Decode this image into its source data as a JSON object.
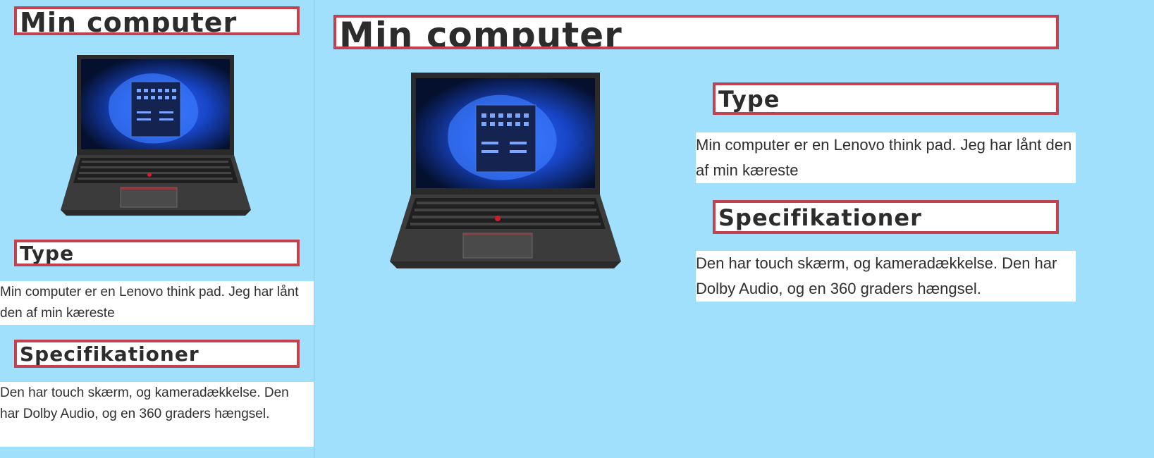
{
  "left": {
    "title": "Min computer",
    "type_heading": "Type",
    "type_text": "Min computer er en Lenovo think pad. Jeg har lånt den af min kæreste",
    "spec_heading": "Specifikationer",
    "spec_text": "Den har touch skærm, og kameradækkelse. Den har Dolby Audio, og en 360 graders hængsel."
  },
  "right": {
    "title": "Min computer",
    "type_heading": "Type",
    "type_text": "Min computer er en Lenovo think pad. Jeg har lånt den af min kæreste",
    "spec_heading": "Specifikationer",
    "spec_text": "Den har touch skærm, og kameradækkelse. Den har Dolby Audio, og en 360 graders hængsel."
  },
  "colors": {
    "background": "#a1e0fc",
    "heading_border": "#c4424f",
    "text": "#2f2f2f"
  },
  "images": {
    "laptop": "laptop-image"
  }
}
